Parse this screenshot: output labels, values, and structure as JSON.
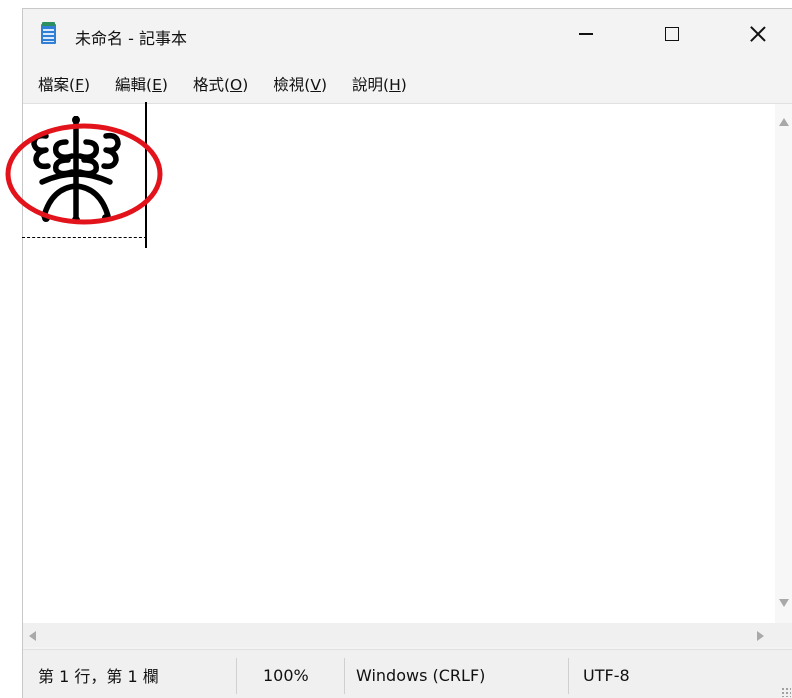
{
  "window": {
    "title": "未命名 - 記事本"
  },
  "menu": [
    {
      "label": "檔案(",
      "key": "F",
      "tail": ")"
    },
    {
      "label": "編輯(",
      "key": "E",
      "tail": ")"
    },
    {
      "label": "格式(",
      "key": "O",
      "tail": ")"
    },
    {
      "label": "檢視(",
      "key": "V",
      "tail": ")"
    },
    {
      "label": "說明(",
      "key": "H",
      "tail": ")"
    }
  ],
  "editor": {
    "content_glyph": "樂",
    "annotation": "red-circle-highlight"
  },
  "status": {
    "position": "第 1 行，第 1 欄",
    "zoom": "100%",
    "line_ending": "Windows (CRLF)",
    "encoding": "UTF-8"
  },
  "icons": {
    "app": "notepad-icon",
    "minimize": "minimize-icon",
    "maximize": "maximize-icon",
    "close": "close-icon"
  },
  "colors": {
    "annotation_ring": "#e3131b",
    "app_icon": "#2f7fd6"
  }
}
